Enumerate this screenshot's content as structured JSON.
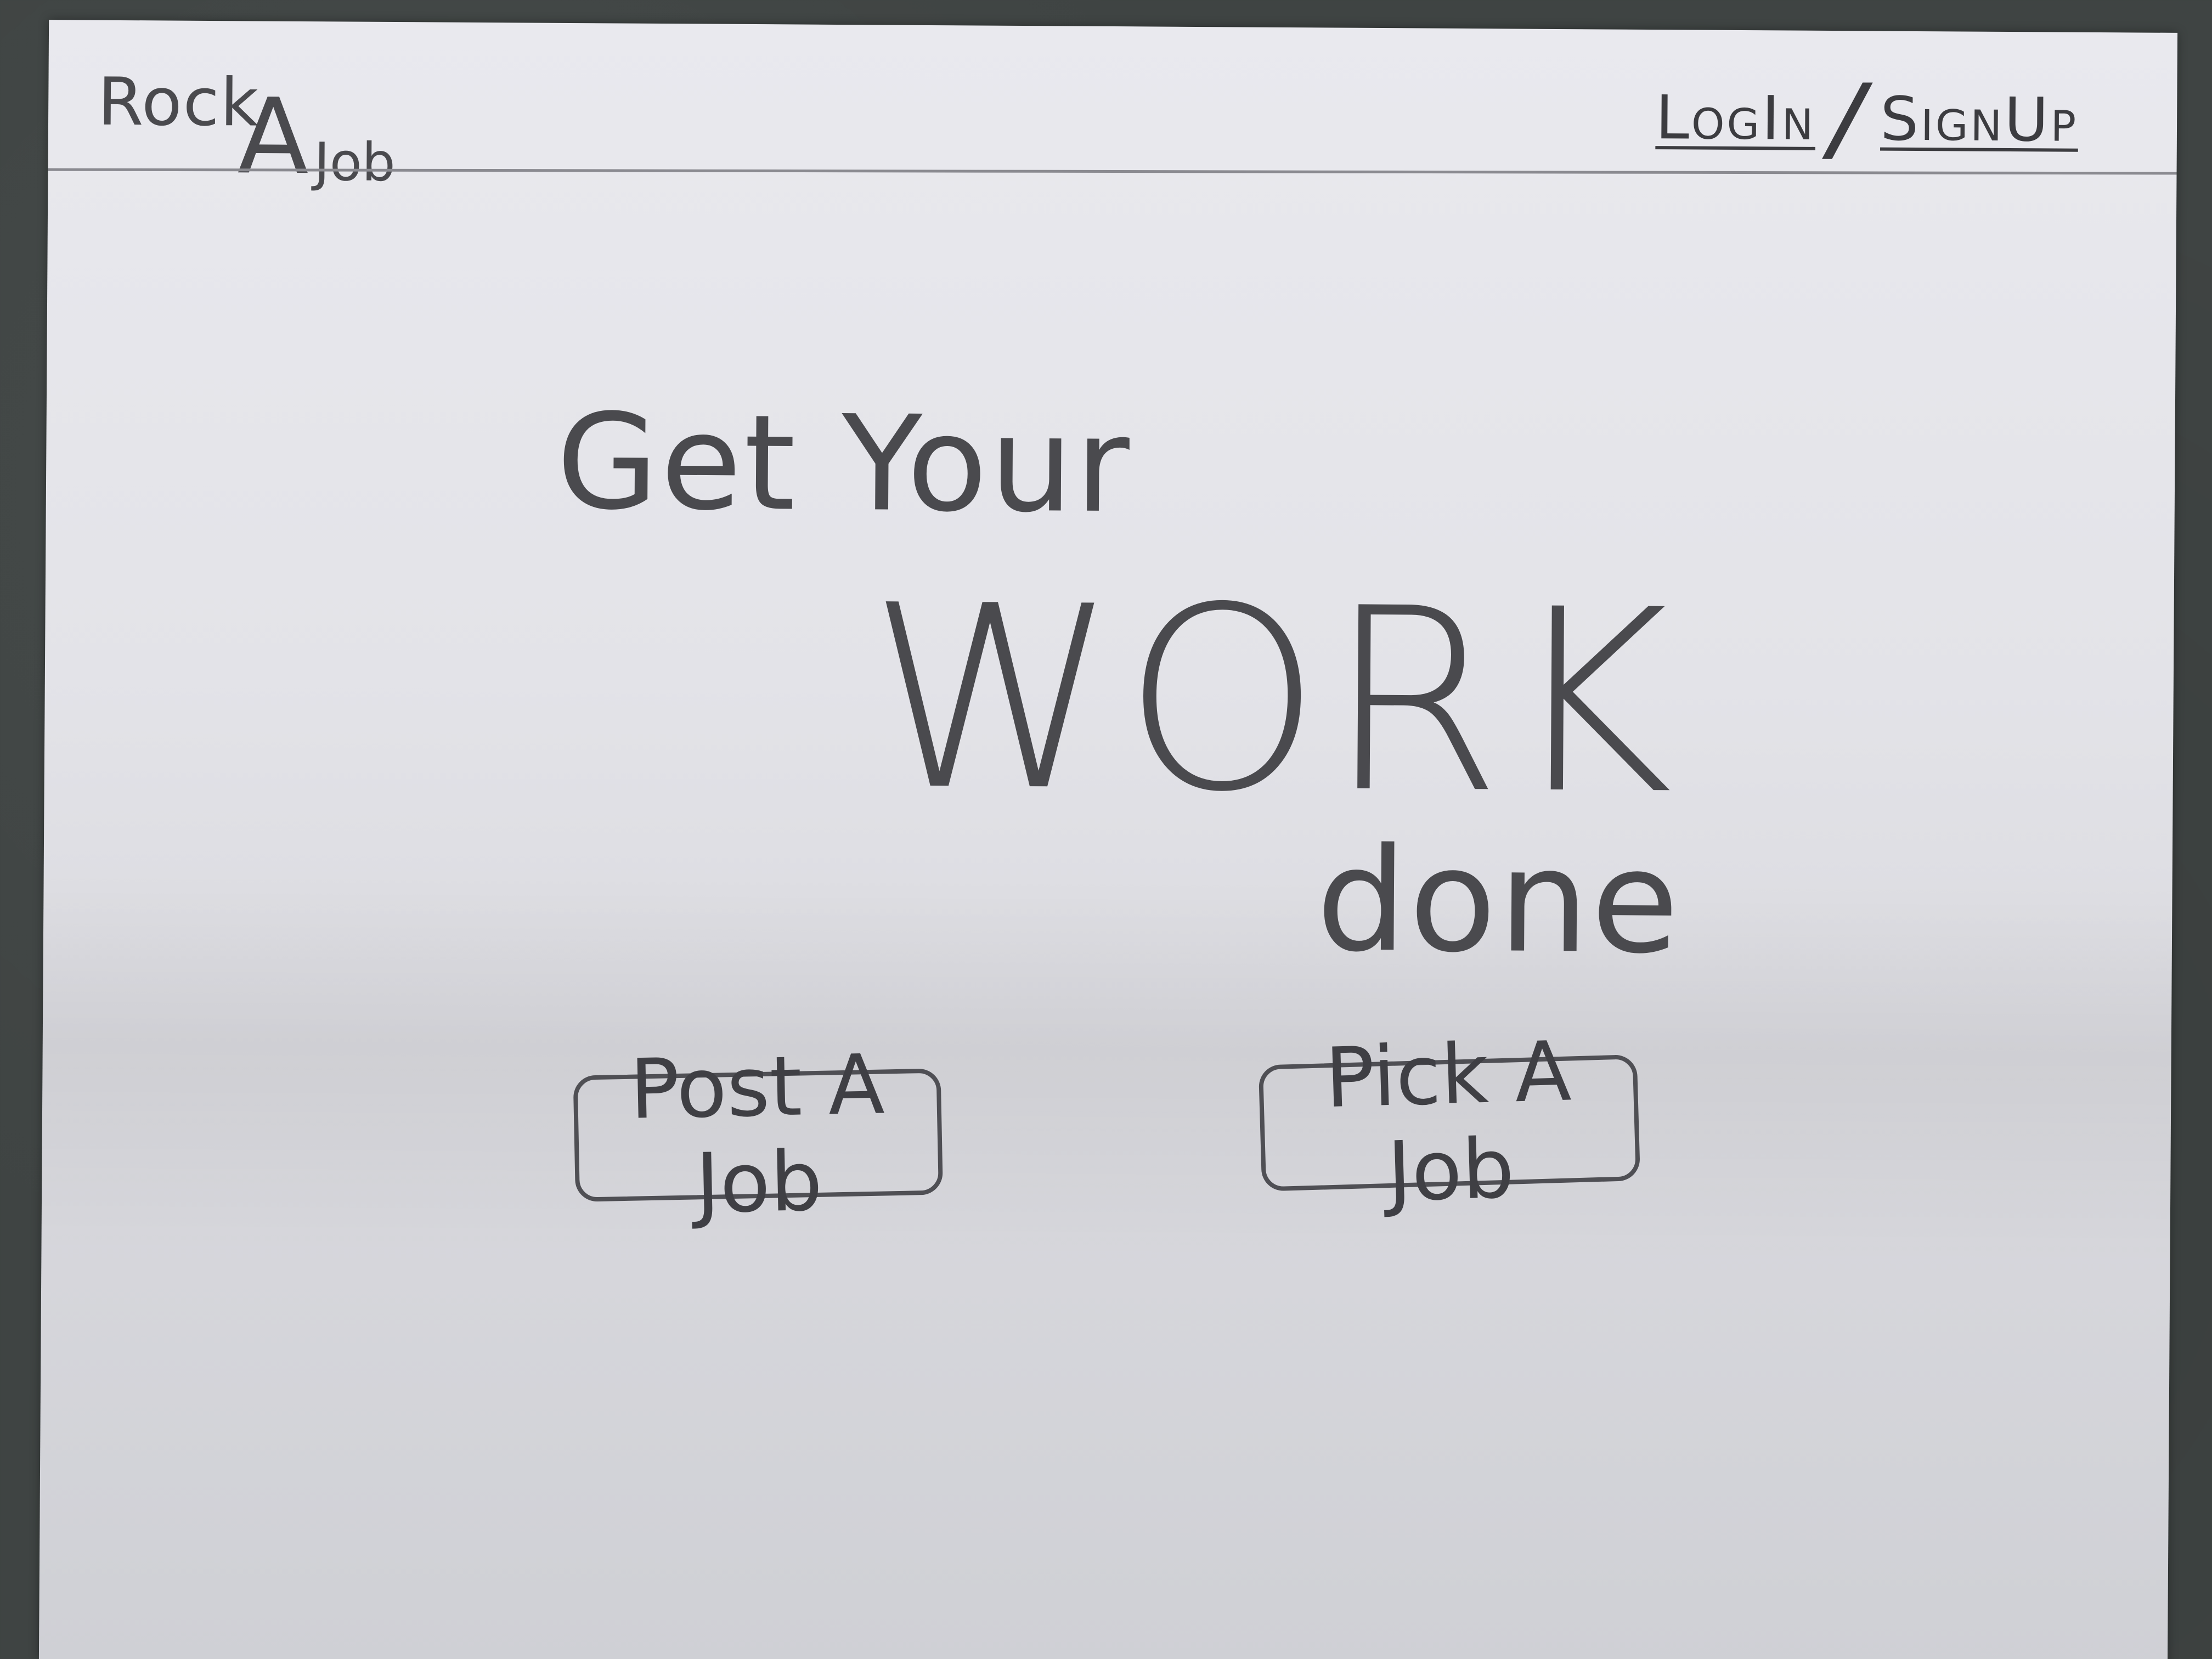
{
  "header": {
    "logo": {
      "rock": "Rock",
      "a": "A",
      "job": "Job"
    },
    "auth": {
      "login_label": "LogIn",
      "separator": "/",
      "signup_label": "SignUp"
    }
  },
  "hero": {
    "line1": "Get Your",
    "line2": "WORK",
    "line3": "done"
  },
  "actions": {
    "post_label": "Post A Job",
    "pick_label": "Pick A Job"
  }
}
